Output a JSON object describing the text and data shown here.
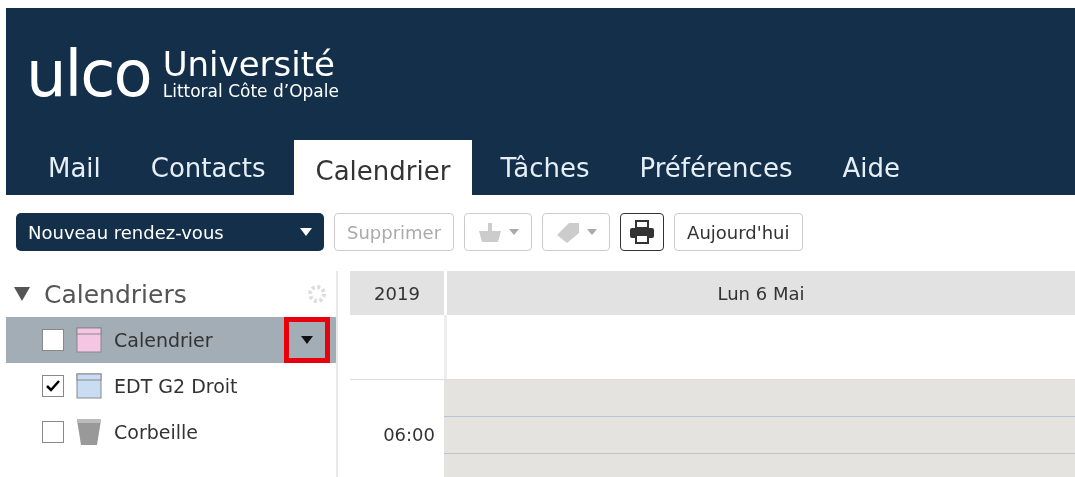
{
  "header": {
    "logo": "ulco",
    "title": "Université",
    "subtitle": "Littoral Côte d’Opale"
  },
  "tabs": [
    {
      "label": "Mail",
      "selected": false
    },
    {
      "label": "Contacts",
      "selected": false
    },
    {
      "label": "Calendrier",
      "selected": true
    },
    {
      "label": "Tâches",
      "selected": false
    },
    {
      "label": "Préférences",
      "selected": false
    },
    {
      "label": "Aide",
      "selected": false
    }
  ],
  "toolbar": {
    "new_button": "Nouveau rendez-vous",
    "delete_button": {
      "label": "Supprimer",
      "disabled": true
    },
    "today_button": "Aujourd'hui"
  },
  "sidebar": {
    "title": "Calendriers",
    "expanded": true,
    "items": [
      {
        "label": "Calendrier",
        "kind": "calendar",
        "color": "#f4c6e4",
        "checked": false,
        "selected": true,
        "highlighted": true
      },
      {
        "label": "EDT G2 Droit",
        "kind": "calendar",
        "color": "#c9dcf4",
        "checked": true,
        "selected": false
      },
      {
        "label": "Corbeille",
        "kind": "trash",
        "checked": false,
        "selected": false
      }
    ]
  },
  "calendar": {
    "year": "2019",
    "day": "Lun 6 Mai",
    "times": [
      "06:00"
    ]
  }
}
